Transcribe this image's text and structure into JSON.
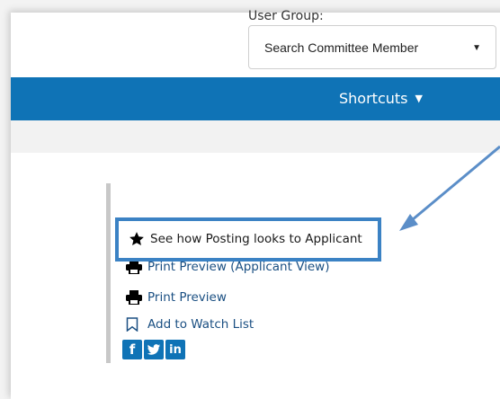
{
  "user_group": {
    "label": "User Group:",
    "selected": "Search Committee Member"
  },
  "topbar": {
    "shortcuts_label": "Shortcuts"
  },
  "menu": {
    "items": [
      {
        "label": "See how Posting looks to Applicant",
        "icon": "star-icon"
      },
      {
        "label": "Print Preview (Applicant View)",
        "icon": "printer-icon"
      },
      {
        "label": "Print Preview",
        "icon": "printer-icon"
      },
      {
        "label": "Add to Watch List",
        "icon": "bookmark-icon"
      }
    ]
  },
  "social": {
    "icons": [
      "facebook-icon",
      "twitter-icon",
      "linkedin-icon"
    ]
  },
  "colors": {
    "brand_blue": "#0f73b6",
    "highlight_blue": "#3b82c4"
  }
}
